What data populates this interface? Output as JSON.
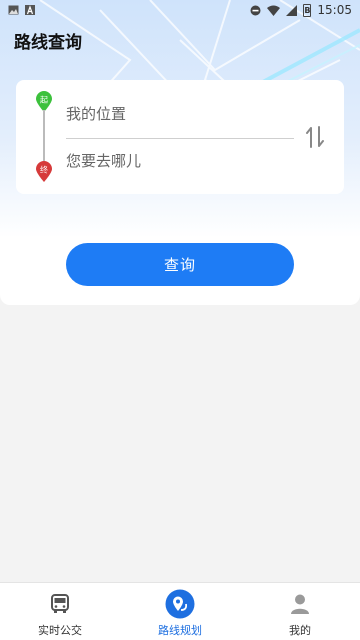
{
  "status_bar": {
    "time": "15:05",
    "battery": "B",
    "left_icons": [
      "image-icon",
      "a-icon"
    ],
    "right_icons": [
      "dnd-icon",
      "wifi-icon",
      "signal-icon",
      "battery-icon"
    ]
  },
  "header": {
    "title": "路线查询"
  },
  "route": {
    "start_pin": "起",
    "end_pin": "终",
    "start_placeholder": "我的位置",
    "end_placeholder": "您要去哪儿",
    "swap_icon": "swap-vertical-icon"
  },
  "search_button": {
    "label": "查询"
  },
  "bottom_nav": {
    "items": [
      {
        "label": "实时公交",
        "icon": "bus-icon",
        "active": false
      },
      {
        "label": "路线规划",
        "icon": "route-pin-icon",
        "active": true
      },
      {
        "label": "我的",
        "icon": "person-icon",
        "active": false
      }
    ]
  },
  "colors": {
    "accent": "#1e7cf5",
    "start_pin": "#3cc13c",
    "end_pin": "#d63a3a",
    "active_tab": "#1e6fe0"
  }
}
